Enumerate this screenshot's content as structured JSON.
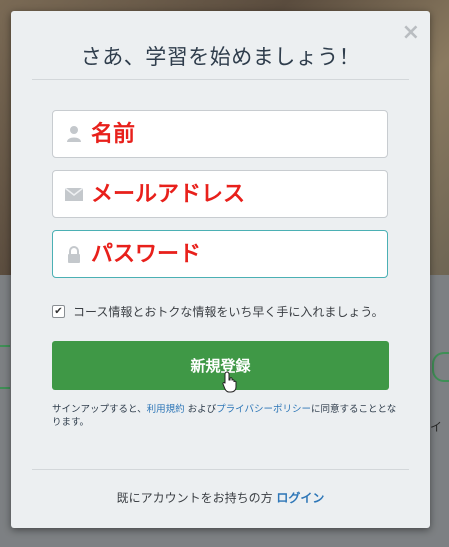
{
  "modal": {
    "title": "さあ、学習を始めましょう！",
    "close_glyph": "×"
  },
  "form": {
    "name_placeholder": "名前",
    "email_placeholder": "メールアドレス",
    "password_placeholder": "パスワード",
    "newsletter_label": "コース情報とおトクな情報をいち早く手に入れましょう。",
    "newsletter_checked": true,
    "submit_label": "新規登録"
  },
  "terms": {
    "prefix": "サインアップすると、",
    "terms_link": "利用規約",
    "and": " および",
    "privacy_link": "プライバシーポリシー",
    "suffix": "に同意することとなります。"
  },
  "footer": {
    "text": "既にアカウントをお持ちの方 ",
    "login_link": "ログイン"
  },
  "colors": {
    "submit_bg": "#3f9846",
    "link": "#2d76b7",
    "placeholder_annotation": "#e8201b",
    "focus_border": "#4bb0b4"
  }
}
